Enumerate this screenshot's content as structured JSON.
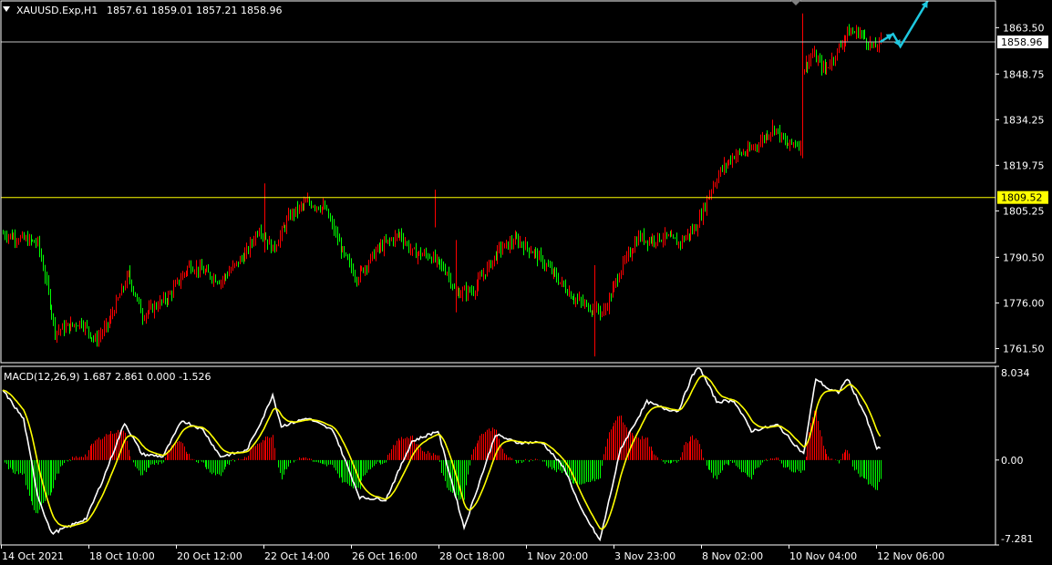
{
  "chart_data": [
    {
      "type": "candlestick",
      "symbol": "XAUUSD.Exp,H1",
      "ohlc_label": "1857.61 1859.01 1857.21 1858.96",
      "ylim": [
        1757,
        1872
      ],
      "y_ticks": [
        1863.5,
        1848.75,
        1834.25,
        1819.75,
        1805.25,
        1790.5,
        1776.0,
        1761.5
      ],
      "y_tick_labels": [
        "1863.50",
        "1848.75",
        "1834.25",
        "1819.75",
        "1805.25",
        "1790.50",
        "1776.00",
        "1761.50"
      ],
      "current_price": "1858.96",
      "horizontal_level": "1809.52",
      "x_tick_labels": [
        "14 Oct 2021",
        "18 Oct 10:00",
        "20 Oct 12:00",
        "22 Oct 14:00",
        "26 Oct 16:00",
        "28 Oct 18:00",
        "1 Nov 20:00",
        "3 Nov 23:00",
        "8 Nov 02:00",
        "10 Nov 04:00",
        "12 Nov 06:00"
      ],
      "close_keypoints": [
        [
          0,
          1798
        ],
        [
          20,
          1795
        ],
        [
          25,
          1782
        ],
        [
          30,
          1767
        ],
        [
          45,
          1770
        ],
        [
          53,
          1764
        ],
        [
          60,
          1769
        ],
        [
          72,
          1785
        ],
        [
          80,
          1772
        ],
        [
          95,
          1778
        ],
        [
          107,
          1788
        ],
        [
          115,
          1786
        ],
        [
          125,
          1783
        ],
        [
          140,
          1792
        ],
        [
          147,
          1800
        ],
        [
          155,
          1793
        ],
        [
          165,
          1804
        ],
        [
          175,
          1808
        ],
        [
          185,
          1806
        ],
        [
          195,
          1792
        ],
        [
          203,
          1784
        ],
        [
          215,
          1793
        ],
        [
          228,
          1798
        ],
        [
          235,
          1792
        ],
        [
          245,
          1791
        ],
        [
          255,
          1786
        ],
        [
          260,
          1779
        ],
        [
          270,
          1780
        ],
        [
          285,
          1793
        ],
        [
          295,
          1796
        ],
        [
          305,
          1792
        ],
        [
          315,
          1786
        ],
        [
          327,
          1778
        ],
        [
          335,
          1775
        ],
        [
          345,
          1773
        ],
        [
          355,
          1787
        ],
        [
          365,
          1797
        ],
        [
          370,
          1796
        ],
        [
          380,
          1797
        ],
        [
          388,
          1795
        ],
        [
          398,
          1800
        ],
        [
          405,
          1810
        ],
        [
          412,
          1818
        ],
        [
          420,
          1823
        ],
        [
          428,
          1824
        ],
        [
          436,
          1828
        ],
        [
          443,
          1832
        ],
        [
          450,
          1826
        ],
        [
          455,
          1827
        ],
        [
          458,
          1826
        ],
        [
          459,
          1850
        ],
        [
          465,
          1855
        ],
        [
          472,
          1850
        ],
        [
          478,
          1855
        ],
        [
          485,
          1862
        ],
        [
          492,
          1862
        ],
        [
          500,
          1857
        ],
        [
          504,
          1858.96
        ]
      ],
      "projection_arrows": "cyan",
      "candle_up_color": "#ff0000",
      "candle_down_color": "#00ff00",
      "level_color": "#ffff00"
    },
    {
      "type": "macd",
      "label": "MACD(12,26,9) 1.687 2.861 0.000 -1.526",
      "ylim": [
        -7.281,
        8.034
      ],
      "y_tick_labels": [
        "8.034",
        "0.00",
        "-7.281"
      ],
      "macd_keypoints": [
        [
          0,
          6.0
        ],
        [
          12,
          3.5
        ],
        [
          20,
          -3
        ],
        [
          28,
          -6.3
        ],
        [
          38,
          -5.7
        ],
        [
          48,
          -5
        ],
        [
          58,
          -1.5
        ],
        [
          70,
          3.2
        ],
        [
          80,
          0.5
        ],
        [
          92,
          0.3
        ],
        [
          103,
          3.4
        ],
        [
          115,
          2.6
        ],
        [
          125,
          0.3
        ],
        [
          140,
          0.8
        ],
        [
          150,
          3.8
        ],
        [
          155,
          5.6
        ],
        [
          160,
          2.9
        ],
        [
          175,
          3.6
        ],
        [
          190,
          2.5
        ],
        [
          205,
          -3.2
        ],
        [
          220,
          -3.4
        ],
        [
          235,
          1.6
        ],
        [
          250,
          2.5
        ],
        [
          265,
          -5.8
        ],
        [
          283,
          2.2
        ],
        [
          295,
          1.5
        ],
        [
          310,
          1.5
        ],
        [
          323,
          -0.8
        ],
        [
          332,
          -4.2
        ],
        [
          343,
          -6.9
        ],
        [
          355,
          1.0
        ],
        [
          370,
          5.0
        ],
        [
          380,
          4.4
        ],
        [
          388,
          4.2
        ],
        [
          396,
          7.2
        ],
        [
          400,
          8.0
        ],
        [
          410,
          5.0
        ],
        [
          420,
          5.1
        ],
        [
          430,
          2.5
        ],
        [
          445,
          3.0
        ],
        [
          460,
          0.5
        ],
        [
          467,
          7.0
        ],
        [
          475,
          6.0
        ],
        [
          480,
          5.8
        ],
        [
          485,
          7.0
        ],
        [
          495,
          4.0
        ],
        [
          502,
          1.0
        ],
        [
          504,
          1.0
        ]
      ],
      "macd_color": "#ffffff",
      "signal_color": "#ffff00",
      "hist_up_color": "#ff0000",
      "hist_down_color": "#00ff00"
    }
  ],
  "colors": {
    "background": "#000000",
    "axis": "#ffffff",
    "current_price_line": "#c0c0c0",
    "projection": "#1ec8e0"
  }
}
